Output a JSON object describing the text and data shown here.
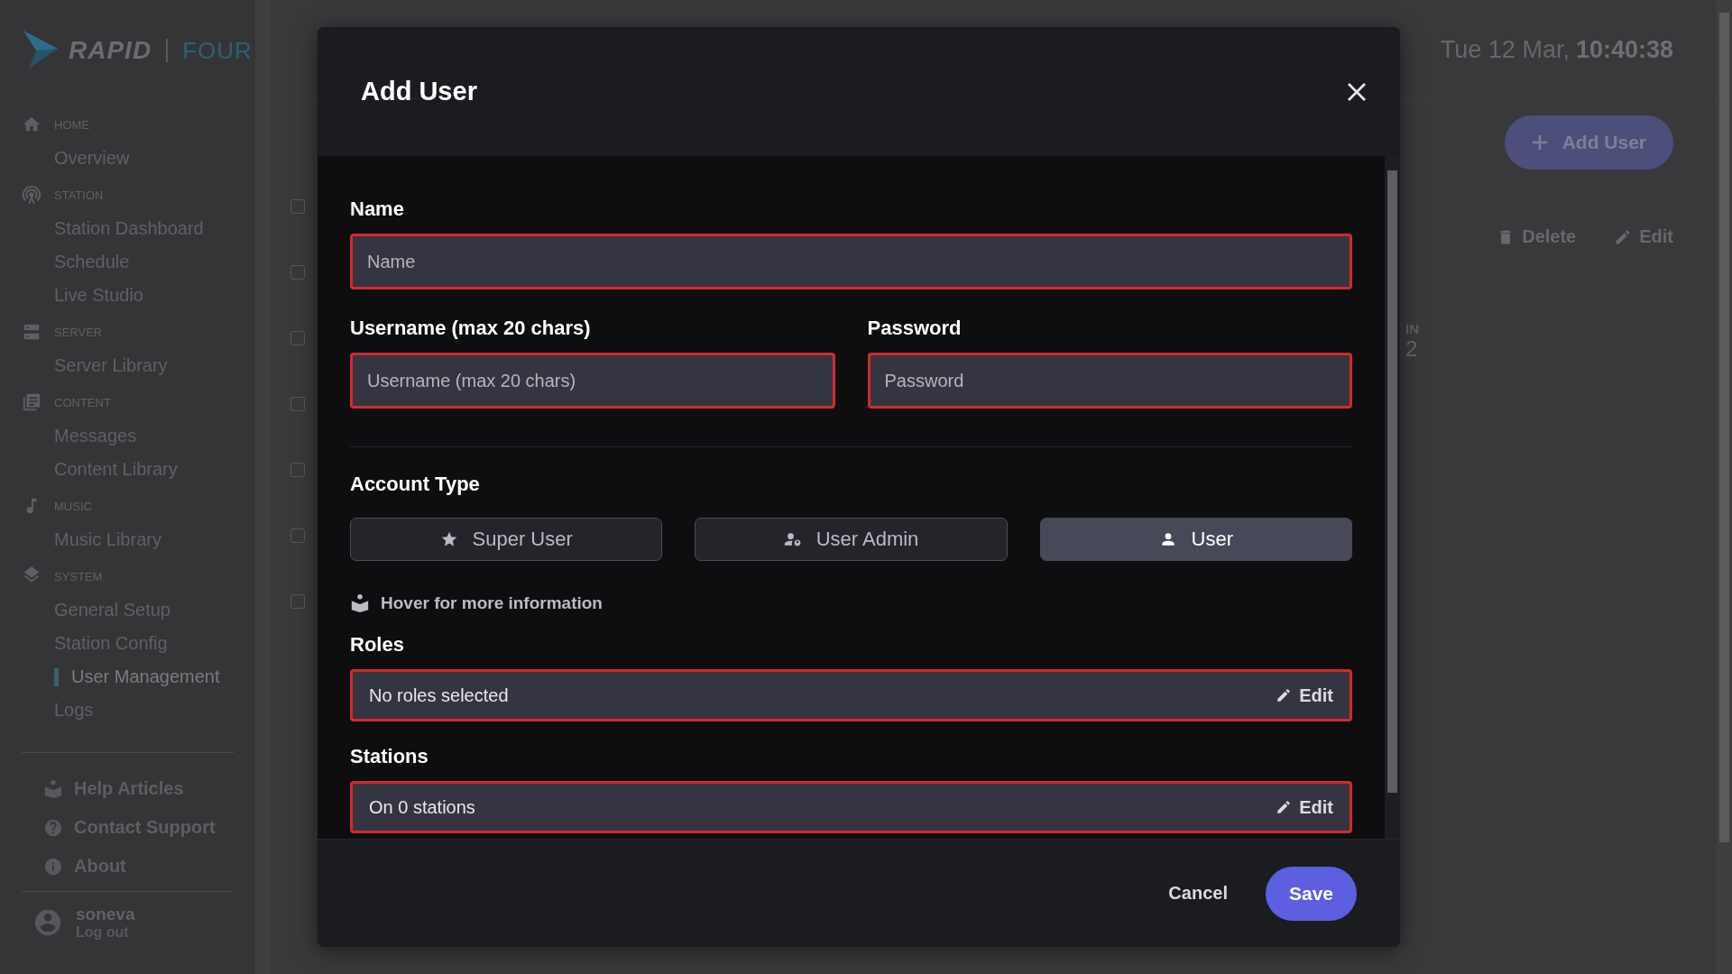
{
  "sidebar": {
    "logo": {
      "brand": "RAPID",
      "product": "FOUR"
    },
    "sections": [
      {
        "kind": "home",
        "heading": "HOME",
        "items": [
          {
            "label": "Overview",
            "selected": false
          }
        ]
      },
      {
        "kind": "station",
        "heading": "STATION",
        "items": [
          {
            "label": "Station Dashboard",
            "selected": false
          },
          {
            "label": "Schedule",
            "selected": false
          },
          {
            "label": "Live Studio",
            "selected": false
          }
        ]
      },
      {
        "kind": "server",
        "heading": "SERVER",
        "items": [
          {
            "label": "Server Library",
            "selected": false
          }
        ]
      },
      {
        "kind": "content",
        "heading": "CONTENT",
        "items": [
          {
            "label": "Messages",
            "selected": false
          },
          {
            "label": "Content Library",
            "selected": false
          }
        ]
      },
      {
        "kind": "music",
        "heading": "MUSIC",
        "items": [
          {
            "label": "Music Library",
            "selected": false
          }
        ]
      },
      {
        "kind": "system",
        "heading": "SYSTEM",
        "items": [
          {
            "label": "General Setup",
            "selected": false
          },
          {
            "label": "Station Config",
            "selected": false
          },
          {
            "label": "User Management",
            "selected": true
          },
          {
            "label": "Logs",
            "selected": false
          }
        ]
      }
    ],
    "help_links": [
      {
        "kind": "help",
        "label": "Help Articles"
      },
      {
        "kind": "support",
        "label": "Contact Support"
      },
      {
        "kind": "about",
        "label": "About"
      }
    ],
    "user": {
      "name": "soneva",
      "action": "Log out"
    }
  },
  "header": {
    "date": "Tue 12 Mar,",
    "time": "10:40:38"
  },
  "page": {
    "add_button": "Add User",
    "actions": [
      {
        "kind": "delete",
        "label": "Delete"
      },
      {
        "kind": "edit",
        "label": "Edit"
      }
    ],
    "column_fragment": "IN",
    "cell_fragment": "2",
    "rows": [
      {
        "checked": false
      },
      {
        "checked": false
      },
      {
        "checked": false
      },
      {
        "checked": false
      },
      {
        "checked": false
      },
      {
        "checked": false
      },
      {
        "checked": false
      }
    ]
  },
  "dialog": {
    "title": "Add User",
    "fields": [
      {
        "label": "Name",
        "placeholder": "Name",
        "invalid": true
      },
      {
        "label": "Username (max 20 chars)",
        "placeholder": "Username (max 20 chars)",
        "invalid": true
      },
      {
        "label": "Password",
        "placeholder": "Password",
        "invalid": true
      }
    ],
    "account_type": {
      "label": "Account Type",
      "options": [
        {
          "kind": "super",
          "label": "Super User",
          "selected": false
        },
        {
          "kind": "admin",
          "label": "User Admin",
          "selected": false
        },
        {
          "kind": "user",
          "label": "User",
          "selected": true
        }
      ]
    },
    "hint": "Hover for more information",
    "pickers": [
      {
        "label": "Roles",
        "value": "No roles selected",
        "action": "Edit",
        "invalid": true
      },
      {
        "label": "Stations",
        "value": "On 0 stations",
        "action": "Edit",
        "invalid": true
      }
    ],
    "cancel": "Cancel",
    "save": "Save"
  }
}
